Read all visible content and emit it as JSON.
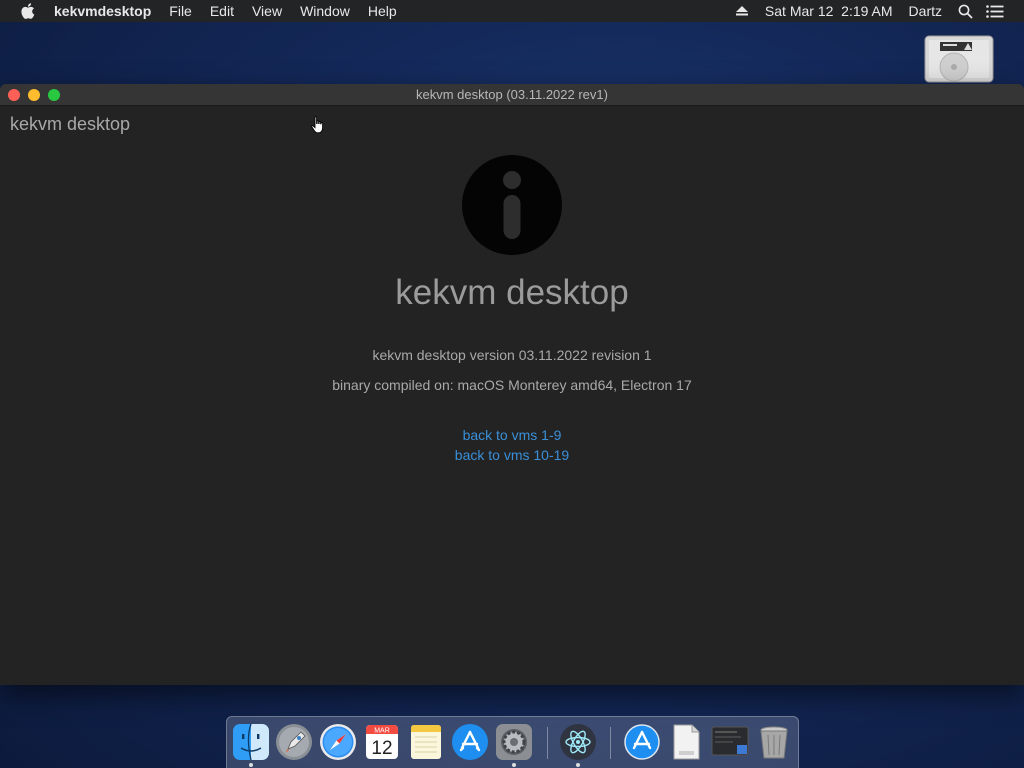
{
  "menubar": {
    "app_name": "kekvmdesktop",
    "items": [
      "File",
      "Edit",
      "View",
      "Window",
      "Help"
    ],
    "datetime": "Sat Mar 12  2:19 AM",
    "user": "Dartz"
  },
  "window": {
    "title": "kekvm desktop (03.11.2022 rev1)",
    "corner_title": "kekvm desktop"
  },
  "about": {
    "heading": "kekvm desktop",
    "version": "kekvm desktop version 03.11.2022 revision 1",
    "compiled": "binary compiled on: macOS Monterey amd64, Electron 17",
    "links": [
      "back to vms 1-9",
      "back to vms 10-19"
    ]
  },
  "dock": {
    "calendar_month": "MAR",
    "calendar_day": "12",
    "items": [
      "finder-icon",
      "launchpad-icon",
      "safari-icon",
      "calendar-icon",
      "notes-icon",
      "app-store-icon",
      "system-preferences-icon",
      "electron-icon",
      "app-store-folder-icon",
      "html-document-icon",
      "screen-recording-icon",
      "trash-icon"
    ]
  },
  "colors": {
    "link": "#3a8fd8",
    "window_bg": "#232323",
    "menubar_bg": "#232426"
  }
}
